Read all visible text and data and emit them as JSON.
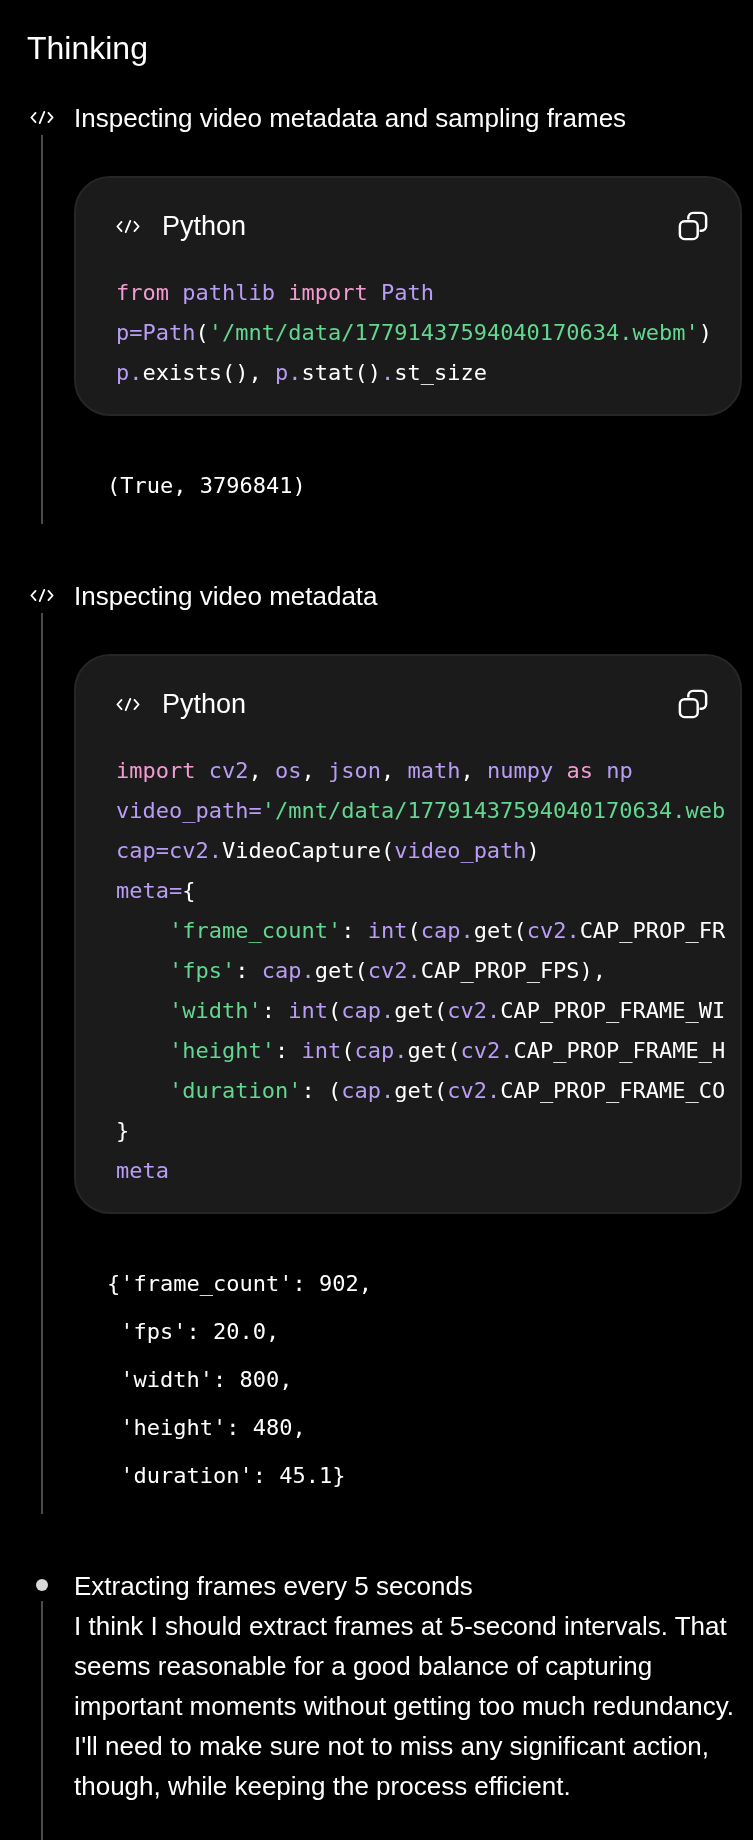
{
  "title": "Thinking",
  "steps": [
    {
      "kind": "code",
      "heading": "Inspecting video metadata and sampling frames",
      "code_block": {
        "language": "Python",
        "lines": [
          [
            {
              "kind": "keyword",
              "text": "from"
            },
            {
              "kind": "name",
              "text": " pathlib"
            },
            {
              "kind": "keyword",
              "text": " import"
            },
            {
              "kind": "name",
              "text": " Path"
            }
          ],
          [
            {
              "kind": "name",
              "text": "p=Path"
            },
            {
              "kind": "plain",
              "text": "("
            },
            {
              "kind": "string",
              "text": "'/mnt/data/17791437594040170634.webm'"
            },
            {
              "kind": "plain",
              "text": ")"
            }
          ],
          [
            {
              "kind": "name",
              "text": "p."
            },
            {
              "kind": "plain",
              "text": "exists(), "
            },
            {
              "kind": "name",
              "text": "p."
            },
            {
              "kind": "plain",
              "text": "stat()"
            },
            {
              "kind": "name",
              "text": "."
            },
            {
              "kind": "plain",
              "text": "st_size"
            }
          ]
        ]
      },
      "output": [
        "(True, 3796841)"
      ]
    },
    {
      "kind": "code",
      "heading": "Inspecting video metadata",
      "code_block": {
        "language": "Python",
        "lines": [
          [
            {
              "kind": "keyword",
              "text": "import"
            },
            {
              "kind": "name",
              "text": " cv2"
            },
            {
              "kind": "plain",
              "text": ", "
            },
            {
              "kind": "name",
              "text": "os"
            },
            {
              "kind": "plain",
              "text": ", "
            },
            {
              "kind": "name",
              "text": "json"
            },
            {
              "kind": "plain",
              "text": ", "
            },
            {
              "kind": "name",
              "text": "math"
            },
            {
              "kind": "plain",
              "text": ", "
            },
            {
              "kind": "name",
              "text": "numpy"
            },
            {
              "kind": "keyword",
              "text": " as"
            },
            {
              "kind": "name",
              "text": " np"
            }
          ],
          [
            {
              "kind": "name",
              "text": "video_path="
            },
            {
              "kind": "string",
              "text": "'/mnt/data/17791437594040170634.web"
            }
          ],
          [
            {
              "kind": "name",
              "text": "cap=cv2."
            },
            {
              "kind": "plain",
              "text": "VideoCapture("
            },
            {
              "kind": "name",
              "text": "video_path"
            },
            {
              "kind": "plain",
              "text": ")"
            }
          ],
          [
            {
              "kind": "name",
              "text": "meta="
            },
            {
              "kind": "plain",
              "text": "{"
            }
          ],
          [
            {
              "kind": "string",
              "text": "    'frame_count'"
            },
            {
              "kind": "plain",
              "text": ": "
            },
            {
              "kind": "name",
              "text": "int"
            },
            {
              "kind": "plain",
              "text": "("
            },
            {
              "kind": "name",
              "text": "cap."
            },
            {
              "kind": "plain",
              "text": "get("
            },
            {
              "kind": "name",
              "text": "cv2."
            },
            {
              "kind": "plain",
              "text": "CAP_PROP_FR"
            }
          ],
          [
            {
              "kind": "string",
              "text": "    'fps'"
            },
            {
              "kind": "plain",
              "text": ": "
            },
            {
              "kind": "name",
              "text": "cap."
            },
            {
              "kind": "plain",
              "text": "get("
            },
            {
              "kind": "name",
              "text": "cv2."
            },
            {
              "kind": "plain",
              "text": "CAP_PROP_FPS),"
            }
          ],
          [
            {
              "kind": "string",
              "text": "    'width'"
            },
            {
              "kind": "plain",
              "text": ": "
            },
            {
              "kind": "name",
              "text": "int"
            },
            {
              "kind": "plain",
              "text": "("
            },
            {
              "kind": "name",
              "text": "cap."
            },
            {
              "kind": "plain",
              "text": "get("
            },
            {
              "kind": "name",
              "text": "cv2."
            },
            {
              "kind": "plain",
              "text": "CAP_PROP_FRAME_WI"
            }
          ],
          [
            {
              "kind": "string",
              "text": "    'height'"
            },
            {
              "kind": "plain",
              "text": ": "
            },
            {
              "kind": "name",
              "text": "int"
            },
            {
              "kind": "plain",
              "text": "("
            },
            {
              "kind": "name",
              "text": "cap."
            },
            {
              "kind": "plain",
              "text": "get("
            },
            {
              "kind": "name",
              "text": "cv2."
            },
            {
              "kind": "plain",
              "text": "CAP_PROP_FRAME_H"
            }
          ],
          [
            {
              "kind": "string",
              "text": "    'duration'"
            },
            {
              "kind": "plain",
              "text": ": ("
            },
            {
              "kind": "name",
              "text": "cap."
            },
            {
              "kind": "plain",
              "text": "get("
            },
            {
              "kind": "name",
              "text": "cv2."
            },
            {
              "kind": "plain",
              "text": "CAP_PROP_FRAME_CO"
            }
          ],
          [
            {
              "kind": "plain",
              "text": "}"
            }
          ],
          [
            {
              "kind": "name",
              "text": "meta"
            }
          ]
        ]
      },
      "output": [
        "{'frame_count': 902,",
        " 'fps': 20.0,",
        " 'width': 800,",
        " 'height': 480,",
        " 'duration': 45.1}"
      ]
    },
    {
      "kind": "bullet",
      "heading": "Extracting frames every 5 seconds",
      "text": "I think I should extract frames at 5-second intervals. That seems reasonable for a good balance of capturing important moments without getting too much redundancy. I'll need to make sure not to miss any significant action, though, while keeping the process efficient."
    }
  ]
}
